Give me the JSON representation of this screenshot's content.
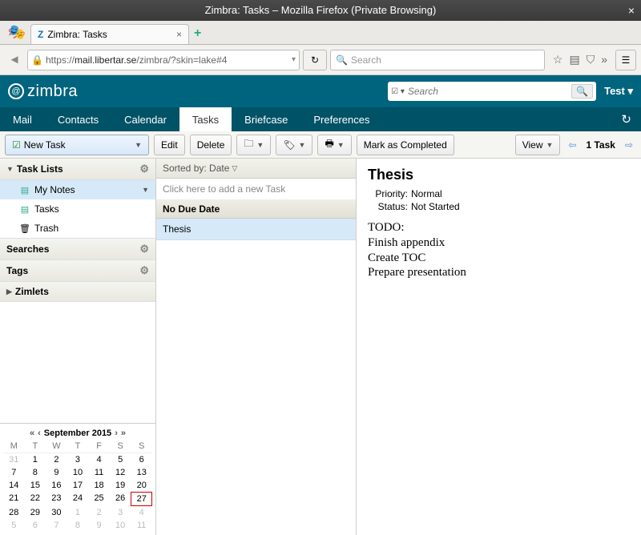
{
  "window": {
    "title": "Zimbra: Tasks – Mozilla Firefox (Private Browsing)"
  },
  "browser_tab": {
    "label": "Zimbra: Tasks"
  },
  "url": {
    "prefix": "https://",
    "domain": "mail.libertar.se",
    "path": "/zimbra/?skin=lake#4"
  },
  "searchbox_placeholder": "Search",
  "zimbra": {
    "logo_text": "zimbra",
    "search_placeholder": "Search",
    "user": "Test"
  },
  "app_tabs": {
    "mail": "Mail",
    "contacts": "Contacts",
    "calendar": "Calendar",
    "tasks": "Tasks",
    "briefcase": "Briefcase",
    "preferences": "Preferences"
  },
  "actions": {
    "new_task": "New Task",
    "edit": "Edit",
    "delete": "Delete",
    "mark_completed": "Mark as Completed",
    "view": "View",
    "count": "1 Task"
  },
  "sidebar": {
    "task_lists_header": "Task Lists",
    "items": {
      "my_notes": "My Notes",
      "tasks": "Tasks",
      "trash": "Trash"
    },
    "searches": "Searches",
    "tags": "Tags",
    "zimlets": "Zimlets"
  },
  "calendar": {
    "month_year": "September 2015",
    "dow": [
      "M",
      "T",
      "W",
      "T",
      "F",
      "S",
      "S"
    ],
    "weeks": [
      [
        {
          "d": "31",
          "g": true
        },
        {
          "d": "1"
        },
        {
          "d": "2"
        },
        {
          "d": "3"
        },
        {
          "d": "4"
        },
        {
          "d": "5"
        },
        {
          "d": "6"
        }
      ],
      [
        {
          "d": "7"
        },
        {
          "d": "8"
        },
        {
          "d": "9"
        },
        {
          "d": "10"
        },
        {
          "d": "11"
        },
        {
          "d": "12"
        },
        {
          "d": "13"
        }
      ],
      [
        {
          "d": "14"
        },
        {
          "d": "15"
        },
        {
          "d": "16"
        },
        {
          "d": "17"
        },
        {
          "d": "18"
        },
        {
          "d": "19"
        },
        {
          "d": "20"
        }
      ],
      [
        {
          "d": "21"
        },
        {
          "d": "22"
        },
        {
          "d": "23"
        },
        {
          "d": "24"
        },
        {
          "d": "25"
        },
        {
          "d": "26"
        },
        {
          "d": "27",
          "t": true
        }
      ],
      [
        {
          "d": "28"
        },
        {
          "d": "29"
        },
        {
          "d": "30"
        },
        {
          "d": "1",
          "g": true
        },
        {
          "d": "2",
          "g": true
        },
        {
          "d": "3",
          "g": true
        },
        {
          "d": "4",
          "g": true
        }
      ],
      [
        {
          "d": "5",
          "g": true
        },
        {
          "d": "6",
          "g": true
        },
        {
          "d": "7",
          "g": true
        },
        {
          "d": "8",
          "g": true
        },
        {
          "d": "9",
          "g": true
        },
        {
          "d": "10",
          "g": true
        },
        {
          "d": "11",
          "g": true
        }
      ]
    ]
  },
  "tasklist": {
    "sorted_by": "Sorted by: Date",
    "add_hint": "Click here to add a new Task",
    "group_header": "No Due Date",
    "items": [
      "Thesis"
    ]
  },
  "pane": {
    "title": "Thesis",
    "priority_label": "Priority:",
    "priority_value": "Normal",
    "status_label": "Status:",
    "status_value": "Not Started",
    "body_lines": [
      "TODO:",
      "Finish appendix",
      "Create TOC",
      "Prepare presentation"
    ]
  }
}
